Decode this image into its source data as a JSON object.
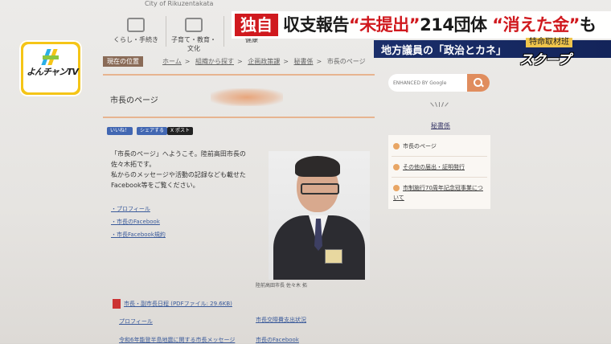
{
  "site": {
    "city_name": "City of Rikuzentakata",
    "nav": [
      {
        "label": "くらし・手続き",
        "icon": "home-icon"
      },
      {
        "label": "子育て・教育・文化",
        "icon": "family-icon"
      },
      {
        "label": "健康",
        "icon": "health-icon"
      }
    ]
  },
  "breadcrumb": {
    "tag": "現在の位置",
    "items": [
      "ホーム",
      "組織から探す",
      "企画政策課",
      "秘書係",
      "市長のページ"
    ],
    "separator": ">"
  },
  "page": {
    "title": "市長のページ",
    "social": {
      "like": "いいね！",
      "share": "シェアする",
      "post": "X ポスト"
    },
    "intro": [
      "「市長のページ」へようこそ。陸前高田市長の佐々木拓です。",
      "私からのメッセージや活動の記録なども載せたFacebook等をご覧ください。"
    ],
    "links": [
      "・プロフィール",
      "・市長のFacebook",
      "・市長Facebook規約"
    ],
    "photo_caption": "陸前高田市長 佐々木 拓",
    "pdf_link": "市長・副市長日程 (PDFファイル: 29.6KB)",
    "sublinks": [
      "プロフィール",
      "市長交際費支出状況",
      "令和6年能登半島地震に関する市長メッセージ",
      "市長のFacebook"
    ]
  },
  "sidebar": {
    "search_label": "ENHANCED BY Google",
    "section_title": "秘書係",
    "items": [
      "市長のページ",
      "その他の届出・証明発行",
      "市制施行70周年記念冠事業について"
    ]
  },
  "overlay": {
    "logo_text": "よんチャンTV",
    "tag": "独自",
    "headline_parts": [
      {
        "text": "収支報告",
        "red": false
      },
      {
        "text": "“未提出”",
        "red": true
      },
      {
        "text": "214団体 ",
        "red": false
      },
      {
        "text": "“消えた金”",
        "red": true
      },
      {
        "text": "も",
        "red": false
      }
    ],
    "subhead": "地方議員の「政治とカネ」",
    "scoop_label": "特命取材班",
    "scoop": "スクープ"
  },
  "colors": {
    "accent": "#d0191e",
    "navy": "#1b2f6b",
    "orange": "#e08d5e",
    "logo_yellow": "#f5c517"
  }
}
